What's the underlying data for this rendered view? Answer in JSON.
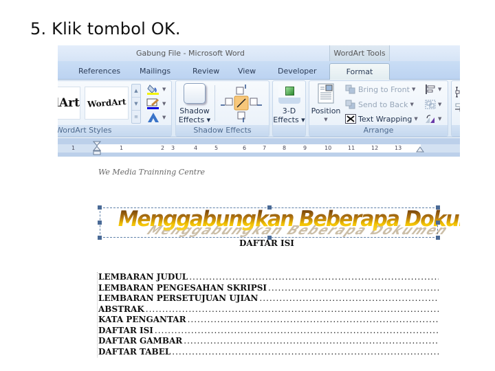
{
  "slide": {
    "title": "5. Klik tombol OK."
  },
  "window": {
    "title": "Gabung File  -  Microsoft Word",
    "contextual_tab_group": "WordArt Tools"
  },
  "tabs": [
    {
      "label": "References",
      "active": false
    },
    {
      "label": "Mailings",
      "active": false
    },
    {
      "label": "Review",
      "active": false
    },
    {
      "label": "View",
      "active": false
    },
    {
      "label": "Developer",
      "active": false
    },
    {
      "label": "Format",
      "active": true
    }
  ],
  "ribbon": {
    "wordart_styles": {
      "label": "WordArt Styles",
      "thumb1": "dArt",
      "thumb2": "WordArt",
      "scroll": [
        "▲",
        "▼",
        "≡"
      ]
    },
    "shadow_effects": {
      "label": "Shadow Effects",
      "button": [
        "Shadow",
        "Effects ▾"
      ]
    },
    "three_d": {
      "button": [
        "3-D",
        "Effects ▾"
      ]
    },
    "arrange": {
      "label": "Arrange",
      "position": "Position",
      "bring_to_front": "Bring to Front",
      "send_to_back": "Send to Back",
      "text_wrapping": "Text Wrapping"
    }
  },
  "ruler": {
    "numbers": [
      "1",
      "1",
      "1",
      "2",
      "3",
      "4",
      "5",
      "6",
      "7",
      "8",
      "9",
      "10",
      "11",
      "12",
      "13"
    ]
  },
  "document": {
    "header": "We Media Trainning Centre",
    "wordart": "Menggabungkan Beberapa Dokumen",
    "toc_title": "DAFTAR ISI",
    "toc_entries": [
      "LEMBARAN JUDUL",
      "LEMBARAN PENGESAHAN SKRIPSI",
      "LEMBARAN PERSETUJUAN UJIAN",
      "ABSTRAK",
      "KATA PENGANTAR",
      "DAFTAR ISI",
      "DAFTAR GAMBAR",
      "DAFTAR TABEL"
    ]
  }
}
